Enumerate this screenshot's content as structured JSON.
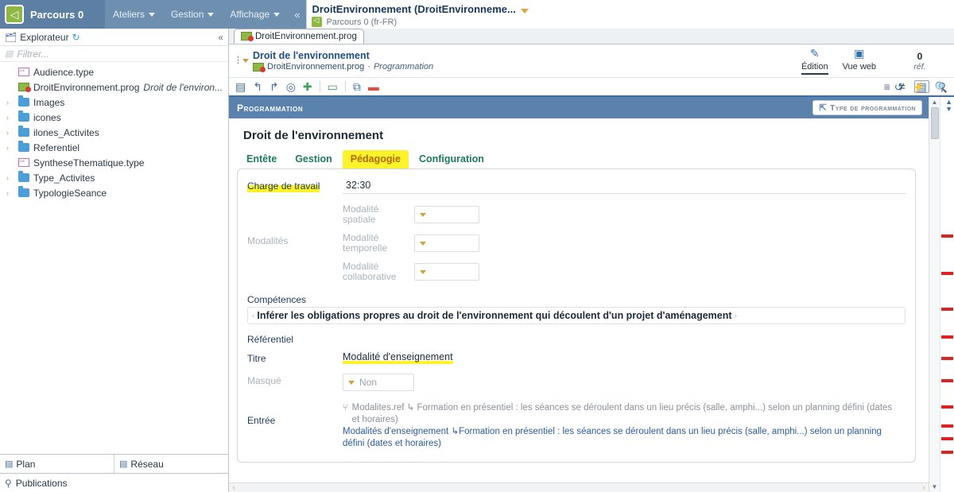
{
  "topbar": {
    "brand": "Parcours 0",
    "brand_icon": "app-logo-icon",
    "menus": [
      {
        "label": "Ateliers"
      },
      {
        "label": "Gestion"
      },
      {
        "label": "Affichage"
      }
    ],
    "collapse": "«",
    "document_title": "DroitEnvironnement (DroitEnvironneme...",
    "document_subtitle": "Parcours 0 (fr-FR)"
  },
  "sidebar": {
    "header": "Explorateur",
    "filter_placeholder": "Filtrer...",
    "tree": [
      {
        "label": "Audience.type",
        "icon": "type-file-icon",
        "arrow": "",
        "suffix": ""
      },
      {
        "label": "DroitEnvironnement.prog",
        "icon": "prog-file-icon",
        "arrow": "",
        "suffix": "Droit de l'environ..."
      },
      {
        "label": "Images",
        "icon": "folder-icon",
        "arrow": "›",
        "suffix": ""
      },
      {
        "label": "icones",
        "icon": "folder-icon",
        "arrow": "›",
        "suffix": ""
      },
      {
        "label": "ilones_Activites",
        "icon": "folder-icon",
        "arrow": "›",
        "suffix": ""
      },
      {
        "label": "Referentiel",
        "icon": "folder-icon",
        "arrow": "›",
        "suffix": ""
      },
      {
        "label": "SyntheseThematique.type",
        "icon": "type-file-icon",
        "arrow": "",
        "suffix": ""
      },
      {
        "label": "Type_Activites",
        "icon": "folder-icon",
        "arrow": "›",
        "suffix": ""
      },
      {
        "label": "TypologieSeance",
        "icon": "folder-icon",
        "arrow": "›",
        "suffix": ""
      }
    ],
    "bottom_tabs": [
      {
        "label": "Plan",
        "icon": "plan-icon"
      },
      {
        "label": "Réseau",
        "icon": "network-icon"
      }
    ],
    "publications": {
      "label": "Publications",
      "icon": "publications-icon"
    }
  },
  "editor": {
    "doc_tab": "DroitEnvironnement.prog",
    "breadcrumb": {
      "title": "Droit de l'environnement",
      "file": "DroitEnvironnement.prog",
      "separator": "·",
      "type": "Programmation"
    },
    "views": [
      {
        "label": "Édition",
        "icon": "pen-icon",
        "active": true
      },
      {
        "label": "Vue web",
        "icon": "web-view-icon",
        "active": false
      }
    ],
    "ref_count": "0",
    "ref_label": "réf.",
    "header_icons": [
      {
        "name": "history-icon",
        "glyph": "↺"
      },
      {
        "name": "lightning-icon",
        "glyph": "⚡"
      },
      {
        "name": "search-icon",
        "glyph": "🔍"
      }
    ],
    "toolbar_left": [
      {
        "name": "save-icon",
        "glyph": "▤",
        "color": "#3f6ea5"
      },
      {
        "name": "undo-icon",
        "glyph": "↰",
        "color": "#3f6ea5"
      },
      {
        "name": "redo-icon",
        "glyph": "↱",
        "color": "#3f6ea5"
      },
      {
        "name": "target-icon",
        "glyph": "◎",
        "color": "#3f6ea5"
      },
      {
        "name": "add-icon",
        "glyph": "✚",
        "color": "#3fa35b"
      },
      {
        "name": "comment-icon",
        "glyph": "▭",
        "color": "#3fa35b"
      },
      {
        "name": "open-window-icon",
        "glyph": "⧉",
        "color": "#3f6ea5"
      },
      {
        "name": "remove-icon",
        "glyph": "▬",
        "color": "#d6524a"
      }
    ],
    "toolbar_right": [
      {
        "name": "filter-settings-icon",
        "glyph": "≡",
        "boxed": false
      },
      {
        "name": "not-equal-icon",
        "glyph": "≠",
        "boxed": false
      },
      {
        "name": "list-view-icon",
        "glyph": "▤",
        "boxed": true
      },
      {
        "name": "hint-icon",
        "glyph": "♀",
        "boxed": false
      }
    ]
  },
  "programmation": {
    "section_title": "Programmation",
    "type_button": "Type de programmation",
    "page_title": "Droit de l'environnement",
    "tabs": [
      {
        "label": "Entête",
        "highlighted": false,
        "active": false
      },
      {
        "label": "Gestion",
        "highlighted": false,
        "active": false
      },
      {
        "label": "Pédagogie",
        "highlighted": true,
        "active": true
      },
      {
        "label": "Configuration",
        "highlighted": false,
        "active": false
      }
    ],
    "fields": {
      "charge_label": "Charge de travail",
      "charge_value": "32:30",
      "modalites_label": "Modalités",
      "modalites": [
        {
          "name": "Modalité spatiale",
          "value": ""
        },
        {
          "name": "Modalité temporelle",
          "value": ""
        },
        {
          "name": "Modalité collaborative",
          "value": ""
        }
      ],
      "competences_label": "Compétences",
      "competences_value": "Inférer les obligations propres au droit de l'environnement qui découlent d'un projet d'aménagement",
      "referentiel_label": "Référentiel",
      "titre_label": "Titre",
      "titre_value": "Modalité d'enseignement",
      "masque_label": "Masqué",
      "masque_value": "Non",
      "entree_label": "Entrée",
      "entree_line1": "Modalites.ref ↳ Formation en présentiel : les séances se déroulent dans un lieu précis (salle, amphi...) selon un planning défini (dates et horaires)",
      "entree_line2": "Modalités d'enseignement ↳Formation en présentiel : les séances se déroulent dans un lieu précis (salle, amphi...) selon un planning défini (dates et horaires)"
    }
  },
  "colors": {
    "brand_blue": "#5c7fa3",
    "header_blue": "#5b82ad",
    "highlight_yellow": "#fdf32a",
    "highlight_orange": "#f25c19",
    "error_red": "#dd2222",
    "tab_green": "#1c7a5f",
    "active_tab_orange": "#b06a00"
  },
  "error_markers": [
    293,
    340,
    385,
    420,
    447,
    475,
    508,
    532,
    548,
    565
  ]
}
